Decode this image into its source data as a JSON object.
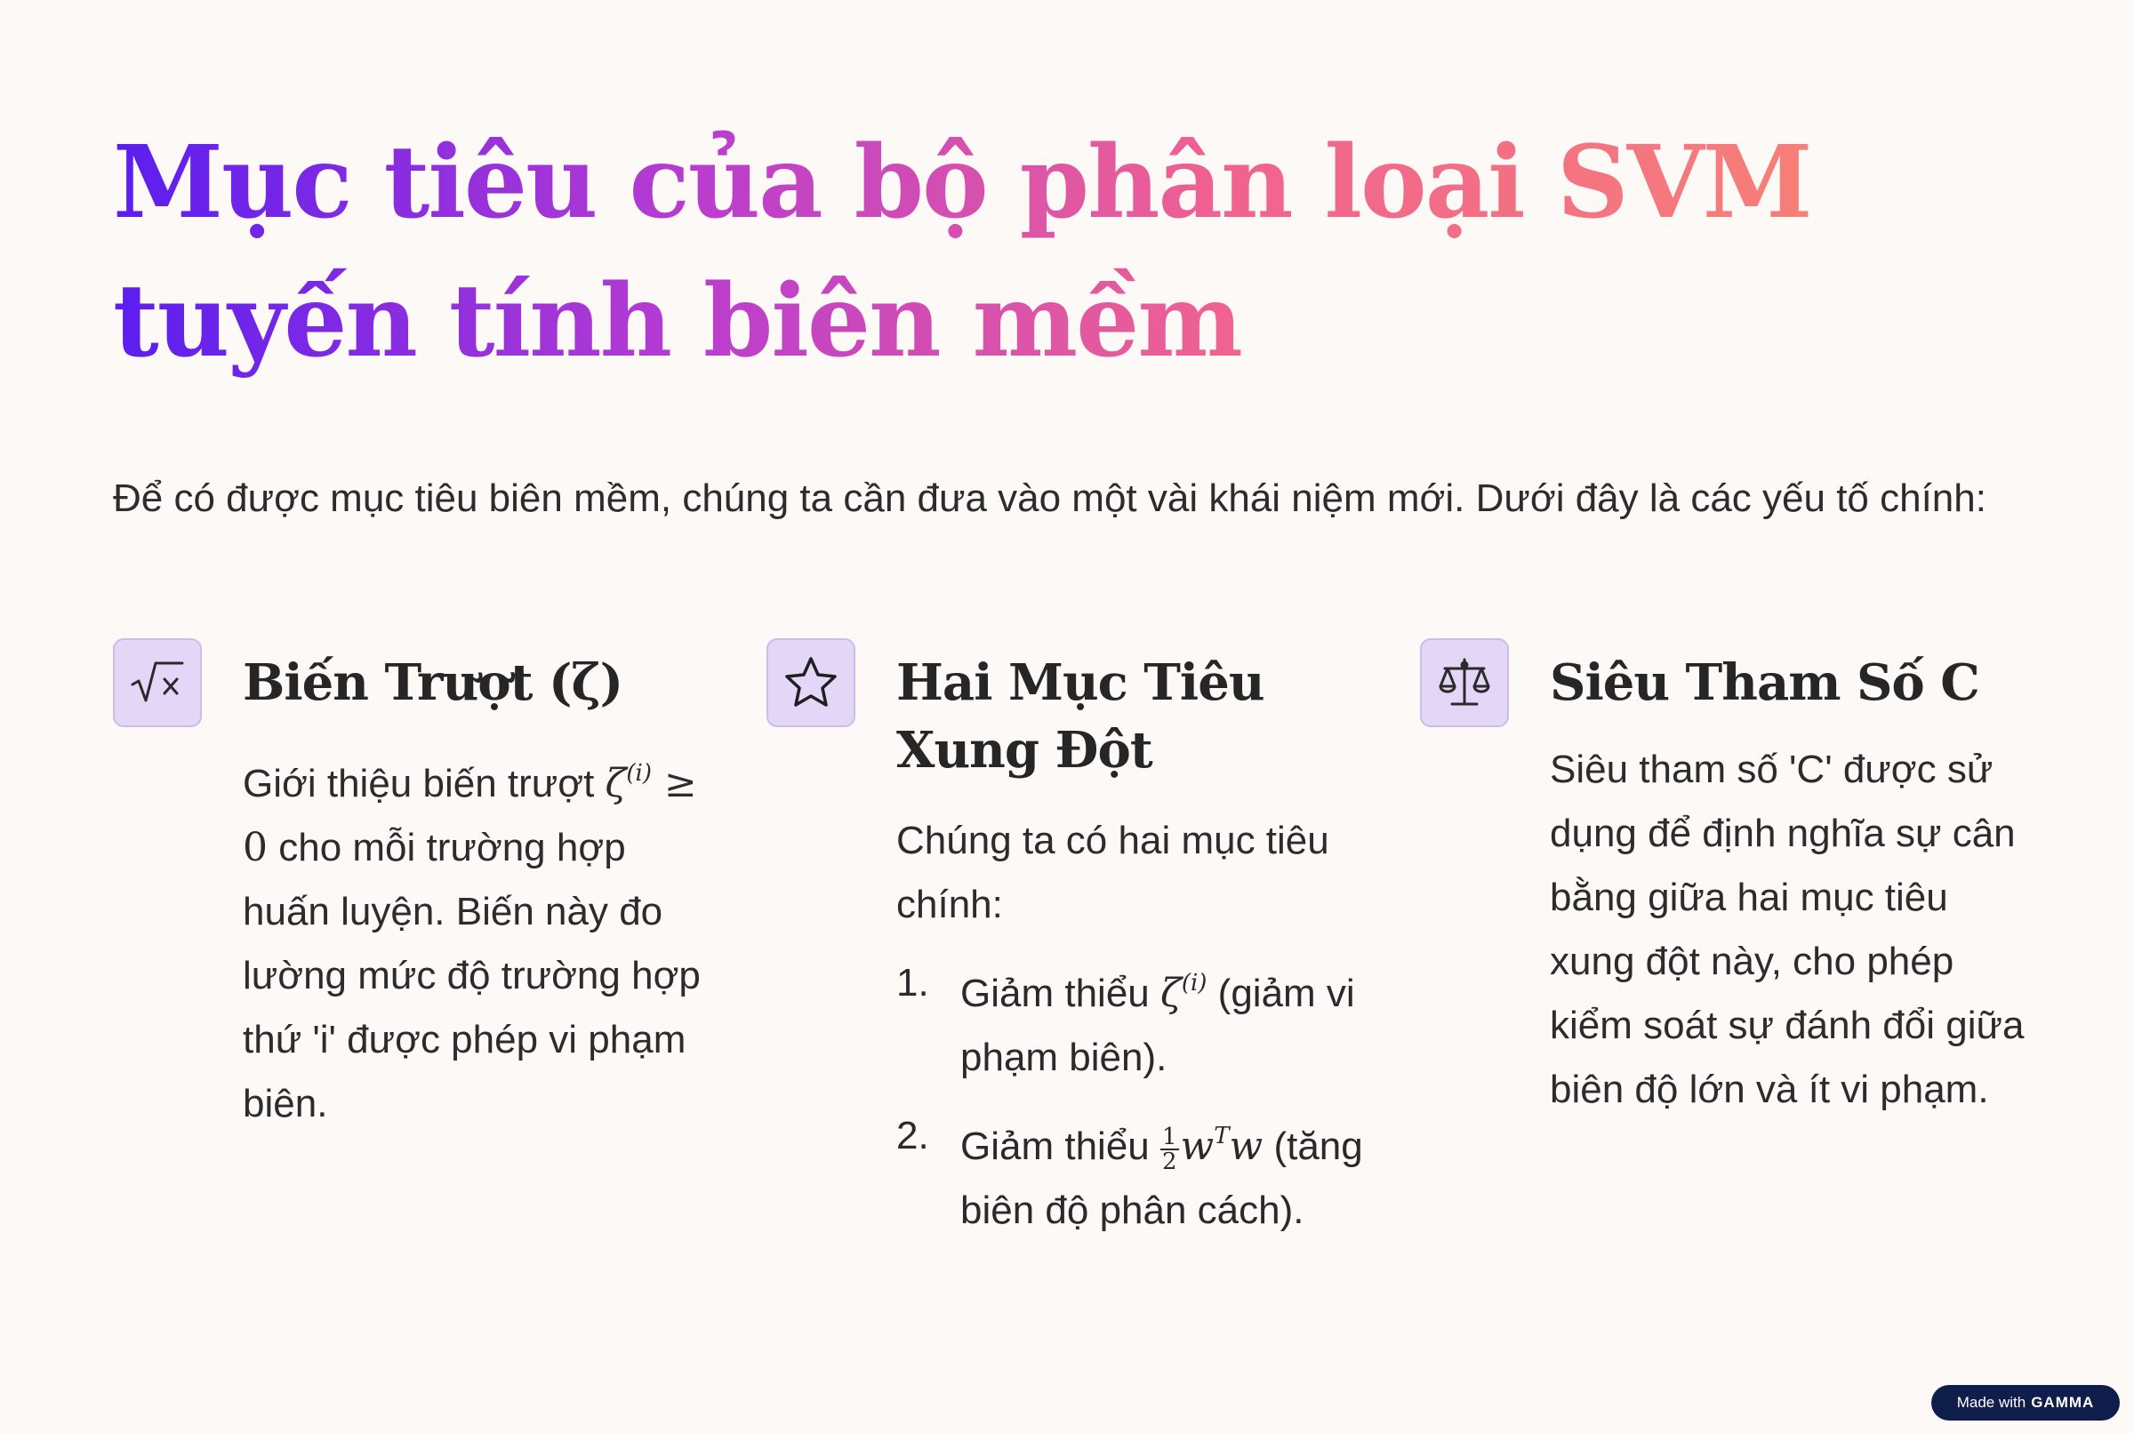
{
  "title": "Mục tiêu của bộ phân loại SVM tuyến tính biên mềm",
  "intro": "Để có được mục tiêu biên mềm, chúng ta cần đưa vào một vài khái niệm mới. Dưới đây là các yếu tố chính:",
  "cards": [
    {
      "icon": "square-root-icon",
      "title": "Biến Trượt (ζ)",
      "text_before": "Giới thiệu biến trượt ",
      "math_symbol": "ζ",
      "math_sup": "(i)",
      "math_rest": " ≥ 0",
      "text_after": " cho mỗi trường hợp huấn luyện. Biến này đo lường mức độ trường hợp thứ 'i' được phép vi phạm biên."
    },
    {
      "icon": "star-icon",
      "title": "Hai Mục Tiêu Xung Đột",
      "text": "Chúng ta có hai mục tiêu chính:",
      "items": [
        {
          "marker": "1.",
          "before": "Giảm thiểu ",
          "math_symbol": "ζ",
          "math_sup": "(i)",
          "after": " (giảm vi phạm biên)."
        },
        {
          "marker": "2.",
          "before": "Giảm thiểu ",
          "frac_num": "1",
          "frac_den": "2",
          "math_base": "w",
          "math_sup": "T",
          "math_tail": "w",
          "after": " (tăng biên độ phân cách)."
        }
      ]
    },
    {
      "icon": "balance-scale-icon",
      "title": "Siêu Tham Số C",
      "text": "Siêu tham số 'C' được sử dụng để định nghĩa sự cân bằng giữa hai mục tiêu xung đột này, cho phép kiểm soát sự đánh đổi giữa biên độ lớn và ít vi phạm."
    }
  ],
  "badge": {
    "prefix": "Made with",
    "brand": "GAMMA"
  },
  "colors": {
    "background": "#fdf9f6",
    "icon_bg": "#e3d6f6",
    "gradient_start": "#5a1ef0",
    "gradient_end": "#f98a6e",
    "badge_bg": "#0f1d4a"
  }
}
